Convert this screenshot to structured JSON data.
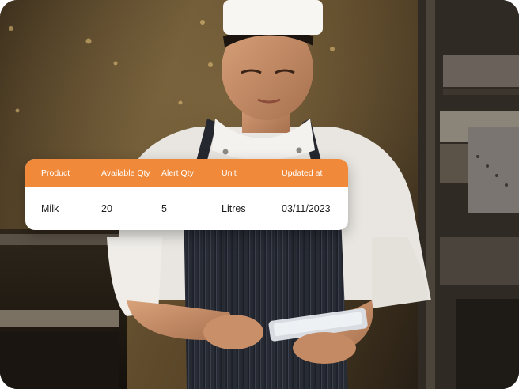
{
  "stock_table": {
    "columns": [
      "Product",
      "Available Qty",
      "Alert Qty",
      "Unit",
      "Updated at"
    ],
    "rows": [
      [
        "Milk",
        "20",
        "5",
        "Litres",
        "03/11/2023"
      ]
    ]
  },
  "colors": {
    "header_bg": "#F0893A",
    "header_text": "#FFFFFF",
    "row_bg": "#FFFFFF",
    "row_text": "#1B1B1B"
  }
}
